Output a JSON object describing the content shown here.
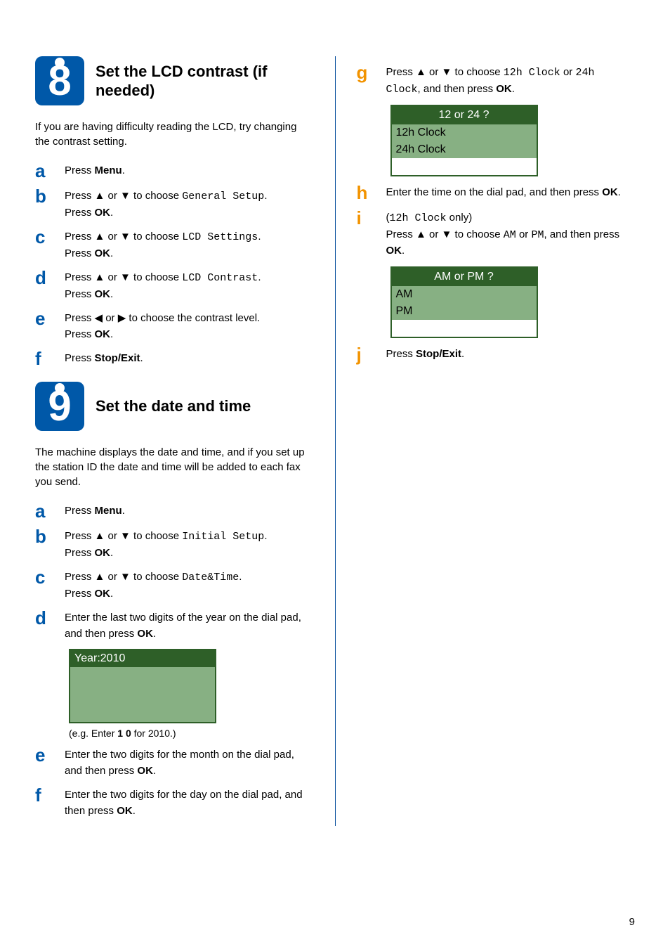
{
  "page_number": "9",
  "left": {
    "section8": {
      "number": "8",
      "title": "Set the LCD contrast (if needed)",
      "intro": "If you are having difficulty reading the LCD, try changing the contrast setting.",
      "a": {
        "press": "Press ",
        "menu": "Menu",
        "dot": "."
      },
      "b": {
        "t1": "Press ",
        "arrows": "a or b",
        "t2": " to choose ",
        "opt": "General Setup",
        "t3": ".",
        "line2a": "Press ",
        "ok": "OK",
        "dot": "."
      },
      "c": {
        "t1": "Press ",
        "arrows": "a or b",
        "t2": " to choose ",
        "opt": "LCD Settings",
        "t3": ".",
        "line2a": "Press ",
        "ok": "OK",
        "dot": "."
      },
      "d": {
        "t1": "Press ",
        "arrows": "a or b",
        "t2": " to choose ",
        "opt": "LCD Contrast",
        "t3": ".",
        "line2a": "Press ",
        "ok": "OK",
        "dot": "."
      },
      "e": {
        "t1": "Press ",
        "arrows": "d or c",
        "t2": " to choose the contrast level.",
        "line2a": "Press ",
        "ok": "OK",
        "dot": "."
      },
      "f": {
        "press": "Press ",
        "stop": "Stop/Exit",
        "dot": "."
      }
    },
    "section9": {
      "number": "9",
      "title": "Set the date and time",
      "intro": "The machine displays the date and time, and if you set up the station ID the date and time will be added to each fax you send.",
      "a": {
        "press": "Press ",
        "menu": "Menu",
        "dot": "."
      },
      "b": {
        "t1": "Press ",
        "arrows": "a or b",
        "t2": " to choose ",
        "opt": "Initial Setup",
        "t3": ".",
        "line2a": "Press ",
        "ok": "OK",
        "dot": "."
      },
      "c": {
        "t1": "Press ",
        "arrows": "a or b",
        "t2": " to choose ",
        "opt": "Date&Time",
        "t3": ".",
        "line2a": "Press ",
        "ok": "OK",
        "dot": "."
      },
      "d": {
        "t1": "Enter the last two digits of the year on the dial pad, and then press ",
        "ok": "OK",
        "dot": "."
      },
      "lcd_year": {
        "top": "Year:2010",
        "caption_pre": "(e.g. Enter ",
        "caption_bold": "1 0",
        "caption_post": " for 2010.)"
      },
      "e": {
        "t1": "Enter the two digits for the month on the dial pad, and then press ",
        "ok": "OK",
        "dot": "."
      },
      "f": {
        "t1": "Enter the two digits for the day on the dial pad, and then press ",
        "ok": "OK",
        "dot": "."
      }
    }
  },
  "right": {
    "g": {
      "t1": "Press ",
      "arrows": "a or b",
      "t2": " to choose ",
      "opt1": "12h Clock",
      "or": " or ",
      "opt2": "24h Clock",
      "t3": ", and then press ",
      "ok": "OK",
      "dot": "."
    },
    "lcd_clock": {
      "title": "12 or 24 ?",
      "row1": "12h Clock",
      "row2": "24h Clock"
    },
    "h": {
      "t1": "Enter the time on the dial pad, and then press ",
      "ok": "OK",
      "dot": "."
    },
    "i": {
      "paren": "(",
      "opt": "12h Clock",
      "only": " only)",
      "t1": "Press ",
      "arrows": "a or b",
      "t2": " to choose ",
      "am": "AM",
      "or": " or ",
      "pm": "PM",
      "t3": ", and then press ",
      "ok": "OK",
      "dot": "."
    },
    "lcd_ampm": {
      "title": "AM or PM ?",
      "row1": "AM",
      "row2": "PM"
    },
    "j": {
      "press": "Press ",
      "stop": "Stop/Exit",
      "dot": "."
    }
  }
}
